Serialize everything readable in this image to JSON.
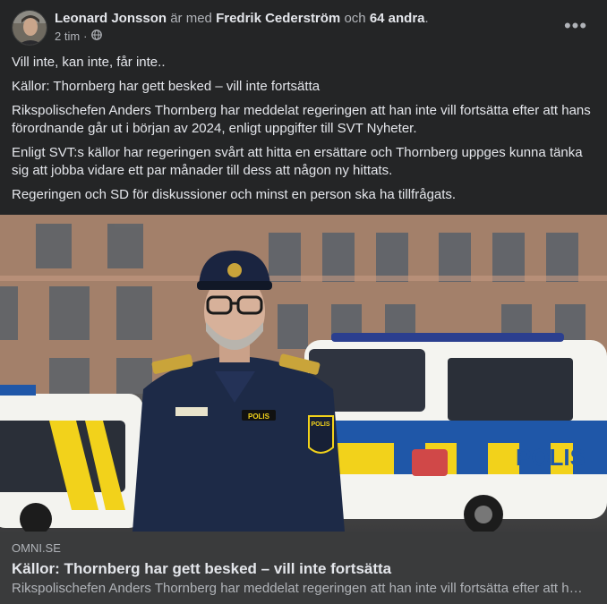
{
  "post": {
    "author": "Leonard Jonsson",
    "with_text": "är med",
    "tagged": "Fredrik Cederström",
    "and_text": "och",
    "others": "64 andra",
    "period": ".",
    "time": "2 tim",
    "separator": "·",
    "audience_icon": "globe-icon",
    "more_icon": "more-options-icon",
    "more_label": "•••",
    "paragraphs": [
      "Vill inte, kan inte, får inte..",
      "Källor: Thornberg har gett besked – vill inte fortsätta",
      "Rikspolischefen Anders Thornberg har meddelat regeringen att han inte vill fortsätta efter att hans förordnande går ut i början av 2024, enligt uppgifter till SVT Nyheter.",
      "Enligt SVT:s källor har regeringen svårt att hitta en ersättare och Thornberg uppges kunna tänka sig att jobba vidare ett par månader till dess att någon ny hittats.",
      "Regeringen och SD för diskussioner och minst en person ska ha tillfrågats."
    ]
  },
  "link_preview": {
    "domain": "OMNI.SE",
    "title": "Källor: Thornberg har gett besked – vill inte fortsätta",
    "description": "Rikspolischefen Anders Thornberg har meddelat regeringen att han inte vill fortsätta efter att hans förordnande går ut i början av 2024, enligt uppgifter till SVT Nyheter.",
    "image_labels": {
      "van_text": "POLIS",
      "badge_text": "POLIS",
      "chest_text": "POLIS"
    }
  },
  "colors": {
    "card_bg": "#242526",
    "link_footer_bg": "#3a3b3c",
    "primary_text": "#e4e6eb",
    "secondary_text": "#b0b3b8",
    "police_blue": "#1f57a8",
    "police_yellow": "#f2d21b"
  }
}
